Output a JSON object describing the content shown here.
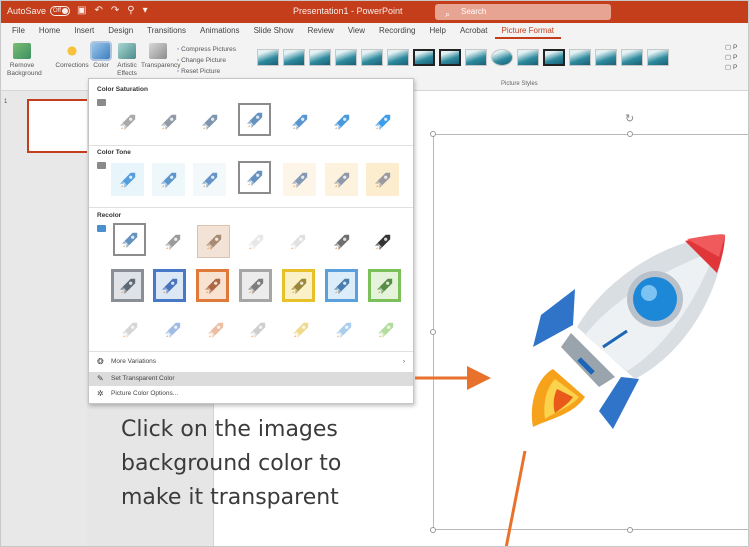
{
  "titlebar": {
    "autosave_label": "AutoSave",
    "toggle_label": "Off",
    "doc_title": "Presentation1 - PowerPoint",
    "search_placeholder": "Search",
    "color": "#c43e1c"
  },
  "menubar": {
    "tabs": [
      "File",
      "Home",
      "Insert",
      "Design",
      "Transitions",
      "Animations",
      "Slide Show",
      "Review",
      "View",
      "Recording",
      "Help",
      "Acrobat",
      "Picture Format"
    ],
    "active_tab": "Picture Format"
  },
  "ribbon": {
    "remove_background": "Remove Background",
    "corrections": "Corrections",
    "color": "Color",
    "artistic_effects": "Artistic Effects",
    "transparency": "Transparency",
    "compress": "Compress Pictures",
    "change": "Change Picture",
    "reset": "Reset Picture",
    "styles_label": "Picture Styles"
  },
  "leftpane": {
    "slide_number": "1"
  },
  "color_menu": {
    "saturation_title": "Color Saturation",
    "tone_title": "Color Tone",
    "recolor_title": "Recolor",
    "more_variations": "More Variations",
    "set_transparent": "Set Transparent Color",
    "color_options": "Picture Color Options..."
  },
  "annotation": {
    "line1": "Click on the images",
    "line2": "background color to",
    "line3": "make it transparent",
    "arrow_color": "#e8722c"
  }
}
